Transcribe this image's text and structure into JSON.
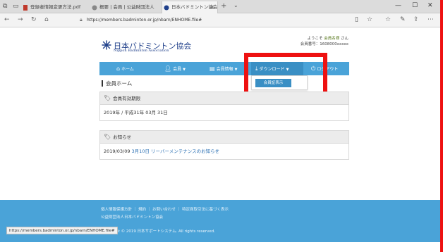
{
  "browser": {
    "tabs": [
      {
        "title": "登録者情報変更方法.pdf",
        "active": false
      },
      {
        "title": "概要 | 会員 | 公益財団法人",
        "active": false
      },
      {
        "title": "日本バドミントン協会 会員",
        "active": true
      }
    ],
    "window_controls": {
      "minimize": "—",
      "maximize": "☐",
      "close": "✕"
    },
    "url": "https://members.badminton.or.jp/nbarn/ENHOME.file#"
  },
  "site": {
    "logo_ja": "日本バドミントン協会",
    "logo_en": "Nippon Badminton Association",
    "user_line1_prefix": "ようこそ",
    "user_name": "会員名様",
    "user_line1_suffix": "さん",
    "user_line2": "会員番号：1608000xxxxx",
    "brand_color": "#4aa3d8"
  },
  "navbar": {
    "items": [
      {
        "label": "ホーム",
        "icon": "home-icon"
      },
      {
        "label": "会員",
        "icon": "person-icon"
      },
      {
        "label": "会員情報",
        "icon": "card-icon"
      },
      {
        "label": "ダウンロード",
        "icon": "download-icon"
      },
      {
        "label": "ログアウト",
        "icon": "logout-icon"
      }
    ]
  },
  "dropdown": {
    "items": [
      {
        "label": "会員証表示"
      }
    ]
  },
  "main": {
    "page_title": "会員ホーム",
    "panels": [
      {
        "heading": "会員有効期限",
        "body": "2019年 / 平成31年 03月 31日"
      },
      {
        "heading": "お知らせ",
        "date": "2019/03/09",
        "body": "3月10日 リーバーメンテナンスのお知らせ"
      }
    ]
  },
  "footer": {
    "line1": "個人情報保護方針 ｜ 規約 ｜ お問い合わせ ｜ 特定商取引法に基づく表示",
    "line2": "公益財団法人日本バドミントン協会",
    "line3": "Copyright © 2019 日本サポートシステム. All rights reserved."
  },
  "status_bar": {
    "url": "https://members.badminton.or.jp/nbarn/ENHOME.file#"
  },
  "colors": {
    "highlight": "#ee1111",
    "nav_bg": "#4aa3d8",
    "dropdown_item": "#3a8fc4"
  }
}
